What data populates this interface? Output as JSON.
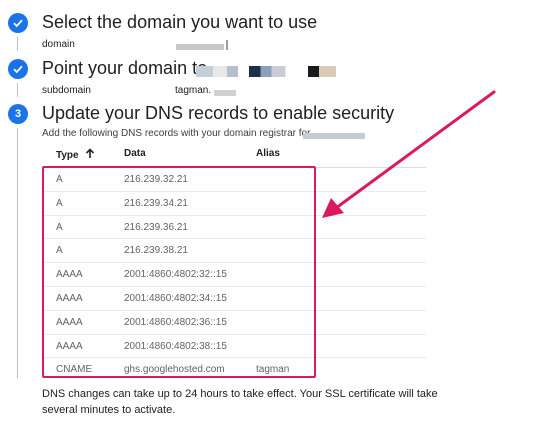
{
  "steps": [
    {
      "number": "1",
      "title": "Select the domain you want to use",
      "state": "complete"
    },
    {
      "number": "2",
      "title": "Point your domain to",
      "state": "complete"
    },
    {
      "number": "3",
      "title": "Update your DNS records to enable security",
      "state": "active"
    }
  ],
  "step1": {
    "label": "domain"
  },
  "step2": {
    "label": "subdomain",
    "value": "tagman."
  },
  "step3": {
    "description": "Add the following DNS records with your domain registrar for",
    "columns": {
      "type": "Type",
      "data": "Data",
      "alias": "Alias"
    },
    "sort_icon": "arrow-up-icon",
    "records": [
      {
        "type": "A",
        "data": "216.239.32.21",
        "alias": ""
      },
      {
        "type": "A",
        "data": "216.239.34.21",
        "alias": ""
      },
      {
        "type": "A",
        "data": "216.239.36.21",
        "alias": ""
      },
      {
        "type": "A",
        "data": "216.239.38.21",
        "alias": ""
      },
      {
        "type": "AAAA",
        "data": "2001:4860:4802:32::15",
        "alias": ""
      },
      {
        "type": "AAAA",
        "data": "2001:4860:4802:34::15",
        "alias": ""
      },
      {
        "type": "AAAA",
        "data": "2001:4860:4802:36::15",
        "alias": ""
      },
      {
        "type": "AAAA",
        "data": "2001:4860:4802:38::15",
        "alias": ""
      },
      {
        "type": "CNAME",
        "data": "ghs.googlehosted.com",
        "alias": "tagman"
      }
    ]
  },
  "note": "DNS changes can take up to 24 hours to take effect. Your SSL certificate will take several minutes to activate.",
  "colors": {
    "accent": "#1a73e8",
    "highlight": "#d81b60"
  }
}
